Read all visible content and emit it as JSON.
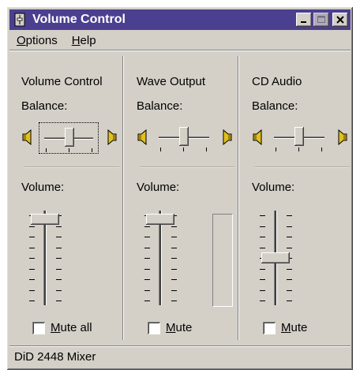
{
  "window": {
    "title": "Volume Control"
  },
  "menu": [
    {
      "label_u": "O",
      "label_rest": "ptions"
    },
    {
      "label_u": "H",
      "label_rest": "elp"
    }
  ],
  "channels": [
    {
      "title": "Volume Control",
      "balance_label": "Balance:",
      "volume_label": "Volume:",
      "balance": 0.5,
      "volume": 0.95,
      "mute_u": "M",
      "mute_rest": "ute all",
      "muted": false,
      "has_meter": false
    },
    {
      "title": "Wave Output",
      "balance_label": "Balance:",
      "volume_label": "Volume:",
      "balance": 0.5,
      "volume": 0.95,
      "mute_u": "M",
      "mute_rest": "ute",
      "muted": false,
      "has_meter": true
    },
    {
      "title": "CD Audio",
      "balance_label": "Balance:",
      "volume_label": "Volume:",
      "balance": 0.5,
      "volume": 0.5,
      "mute_u": "M",
      "mute_rest": "ute",
      "muted": false,
      "has_meter": false
    }
  ],
  "status": {
    "text": "DiD 2448 Mixer"
  },
  "colors": {
    "titlebar": "#4b3f8f",
    "face": "#d4d0c8",
    "speaker": "#e0c020"
  },
  "icons": {
    "app": "volume-app-icon",
    "minimize": "minimize-icon",
    "maximize": "maximize-icon",
    "close": "close-icon",
    "speaker_left": "speaker-left-icon",
    "speaker_right": "speaker-right-icon"
  }
}
